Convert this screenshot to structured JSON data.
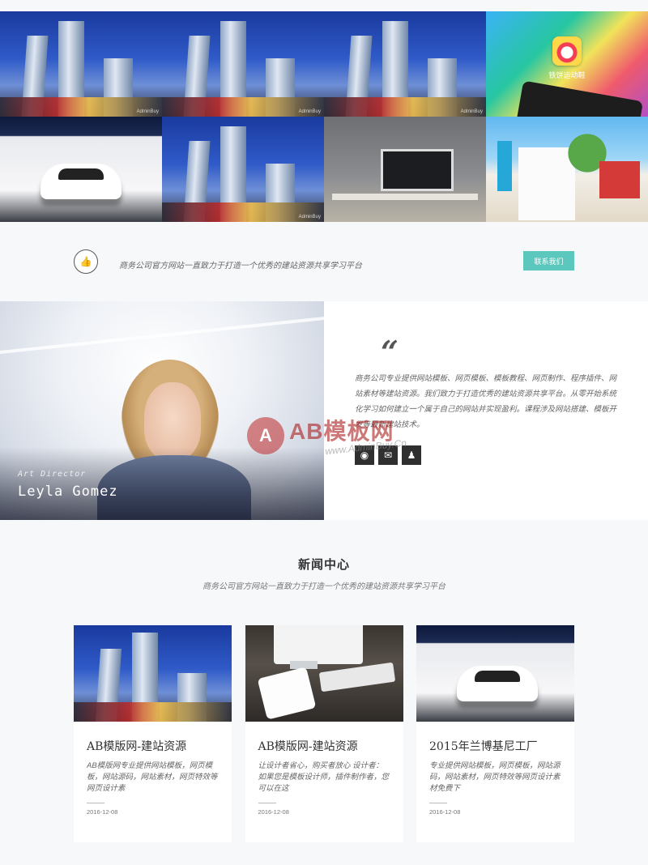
{
  "gallery": {
    "app_label": "铁饼运动鞋",
    "image_mark": "AdminBuy"
  },
  "contact": {
    "text": "商务公司官方网站一直致力于打造一个优秀的建站资源共享学习平台",
    "button": "联系我们"
  },
  "team": {
    "role": "Art Director",
    "name": "Leyla Gomez",
    "quote_mark": "“",
    "quote": "商务公司专业提供网站模板、网页模板、模板教程、网页制作、程序插件、网站素材等建站资源。我们致力于打造优秀的建站资源共享平台。从零开始系统化学习如何建立一个属于自己的网站并实现盈利。课程涉及网站搭建、模板开发等最新建站技术。",
    "socials": [
      {
        "icon": "weibo-icon",
        "glyph": "◉"
      },
      {
        "icon": "wechat-icon",
        "glyph": "✉"
      },
      {
        "icon": "qq-icon",
        "glyph": "♟"
      }
    ]
  },
  "watermark": {
    "mark": "A",
    "title": "AB模板网",
    "url": "www.AdminBuy.Cn"
  },
  "news": {
    "title": "新闻中心",
    "subtitle": "商务公司官方网站一直致力于打造一个优秀的建站资源共享学习平台",
    "cards": [
      {
        "title": "AB模版网-建站资源",
        "excerpt": "AB模版网专业提供网站模板，网页模板，网站源码，网站素材，网页特效等网页设计素",
        "date": "2016-12-08"
      },
      {
        "title": "AB模版网-建站资源",
        "excerpt": "让设计者省心，购买者放心 设计者：如果您是模板设计师，插件制作者，您可以在这",
        "date": "2016-12-08"
      },
      {
        "title": "2015年兰博基尼工厂",
        "excerpt": "专业提供网站模板，网页模板，网站源码，网站素材，网页特效等网页设计素材免费下",
        "date": "2016-12-08"
      }
    ]
  }
}
